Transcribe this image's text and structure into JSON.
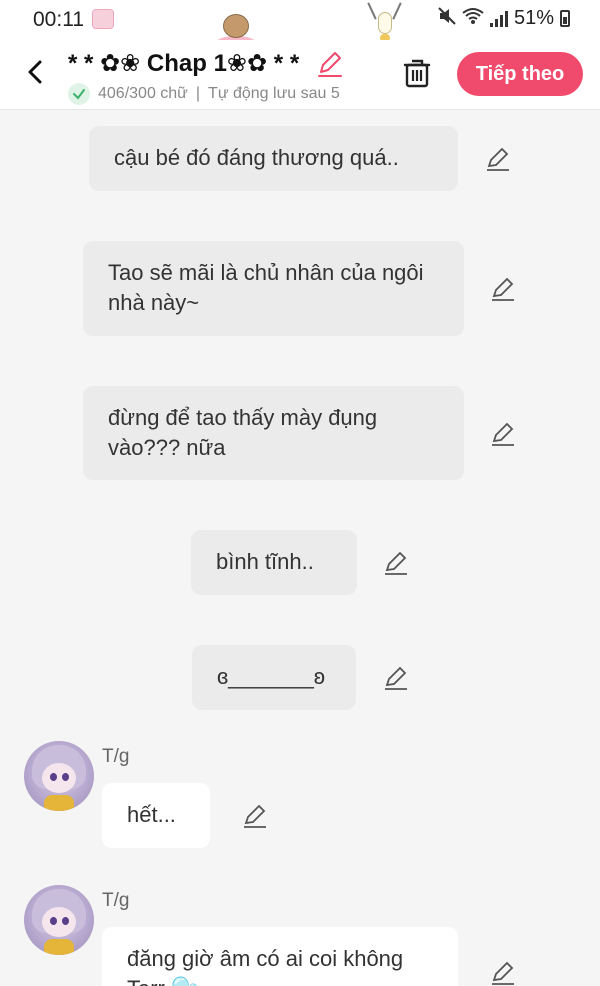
{
  "status_bar": {
    "time": "00:11",
    "battery": "51%",
    "icons": [
      "app-sticker-icon",
      "mute-icon",
      "wifi-icon",
      "signal-icon",
      "battery-icon"
    ]
  },
  "header": {
    "title": "* * ✿❀ Chap 1❀✿ * *",
    "word_count": "406/300 chữ",
    "separator": "|",
    "autosave": "Tự động lưu sau 5",
    "next_label": "Tiếp theo",
    "icons": [
      "back-icon",
      "title-edit-icon",
      "check-icon",
      "trash-icon"
    ]
  },
  "colors": {
    "accent": "#f04a6c",
    "bubble_gray": "#ebebeb",
    "bubble_white": "#ffffff",
    "background": "#f5f5f5",
    "check_green": "#3ab26b"
  },
  "messages": [
    {
      "text": "cậu bé đó đáng thương quá.."
    },
    {
      "text": "Tao sẽ mãi là chủ nhân của ngôi nhà này~"
    },
    {
      "text": "đừng để tao thấy mày đụng vào??? nữa"
    },
    {
      "text": "bình tĩnh.."
    },
    {
      "text": "ɞ_______ʚ"
    },
    {
      "author": "T/g",
      "text": "hết..."
    },
    {
      "author": "T/g",
      "text": "đăng giờ âm có ai coi không Tarr 🫧"
    }
  ]
}
